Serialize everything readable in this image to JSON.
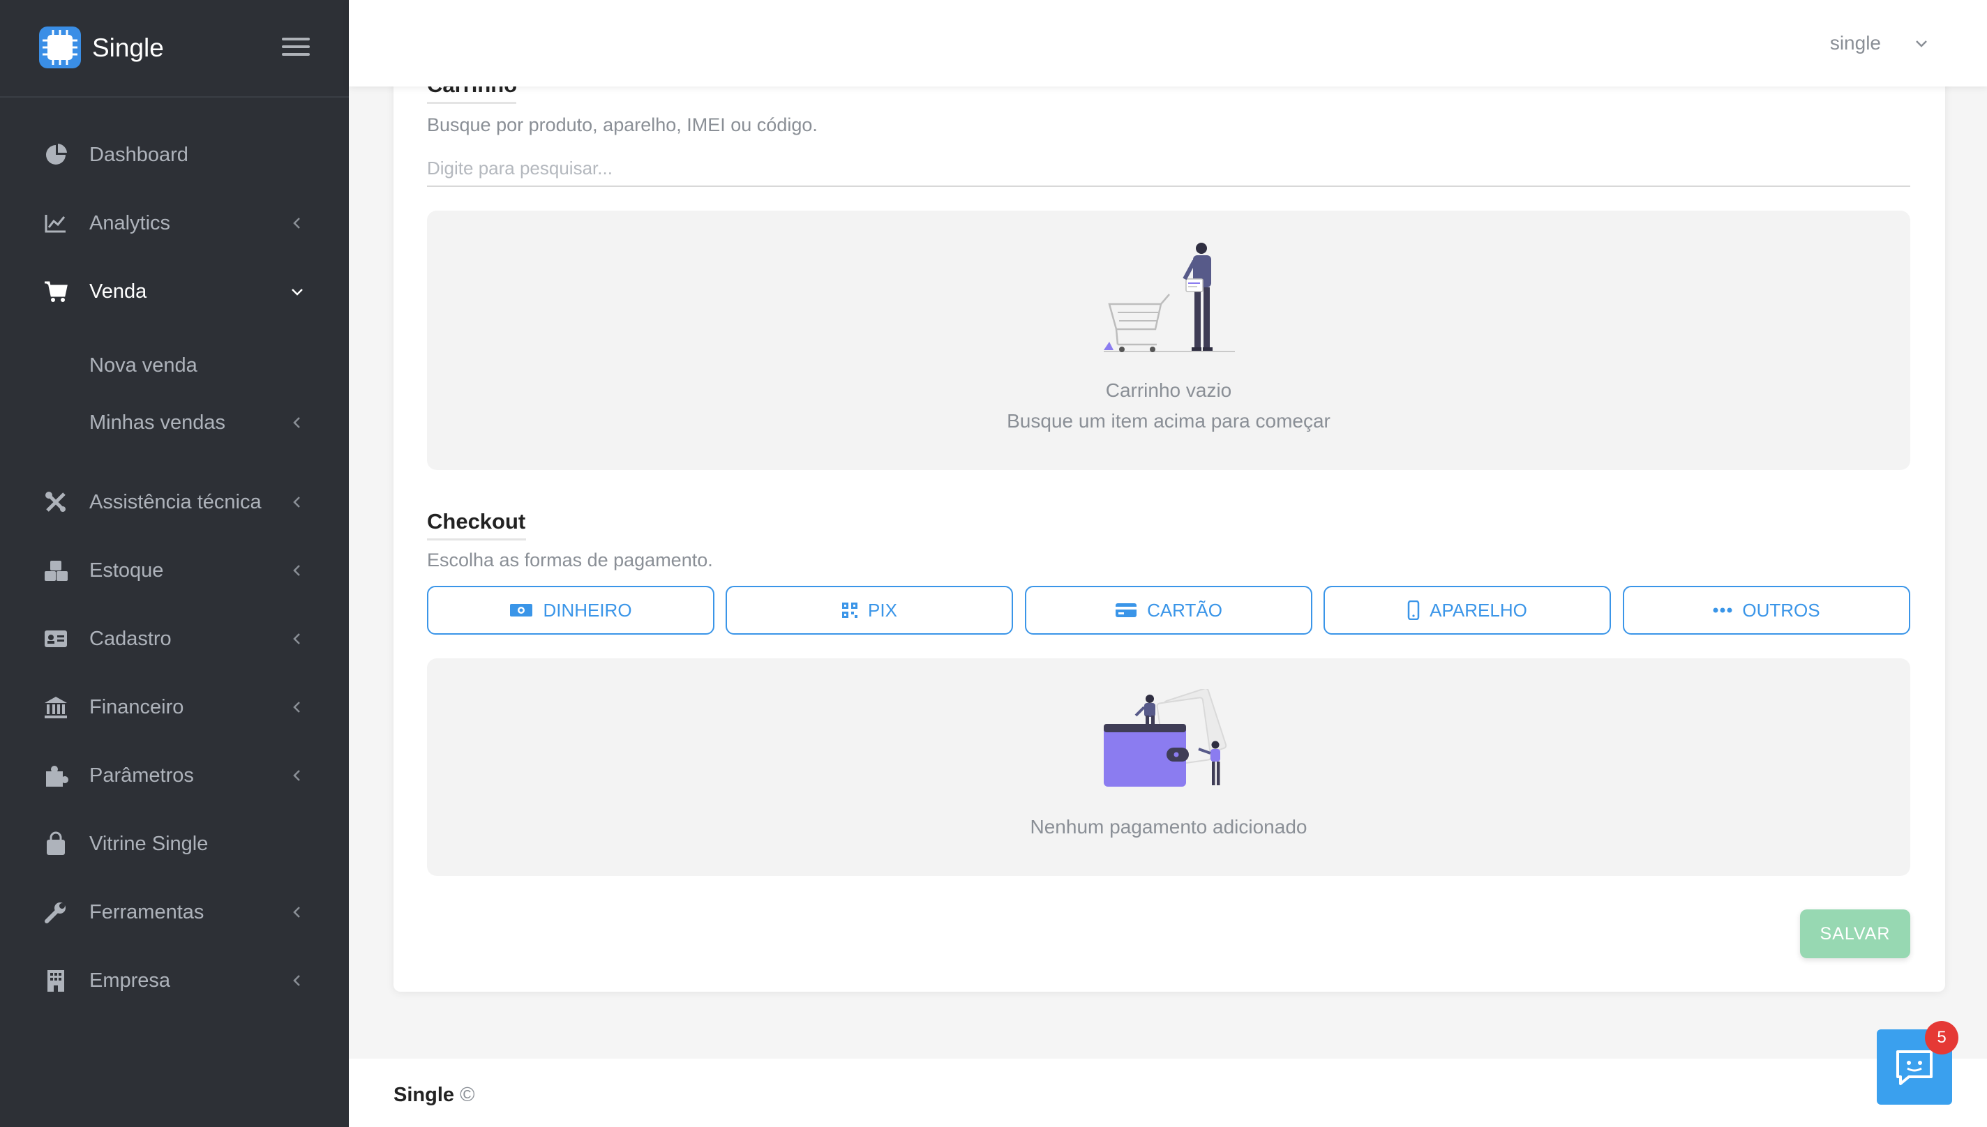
{
  "app": {
    "name": "Single"
  },
  "sidebar": {
    "items": [
      {
        "label": "Dashboard",
        "icon": "pie-chart-icon"
      },
      {
        "label": "Analytics",
        "icon": "line-chart-icon"
      },
      {
        "label": "Venda",
        "icon": "shopping-cart-icon",
        "expanded": true,
        "children": [
          {
            "label": "Nova venda"
          },
          {
            "label": "Minhas vendas"
          }
        ]
      },
      {
        "label": "Assistência técnica",
        "icon": "tools-icon"
      },
      {
        "label": "Estoque",
        "icon": "boxes-icon"
      },
      {
        "label": "Cadastro",
        "icon": "id-card-icon"
      },
      {
        "label": "Financeiro",
        "icon": "bank-icon"
      },
      {
        "label": "Parâmetros",
        "icon": "puzzle-icon"
      },
      {
        "label": "Vitrine Single",
        "icon": "shopping-bag-icon"
      },
      {
        "label": "Ferramentas",
        "icon": "wrench-icon"
      },
      {
        "label": "Empresa",
        "icon": "building-icon"
      }
    ]
  },
  "header": {
    "user": "single"
  },
  "cart": {
    "title": "Carrinho",
    "subtitle": "Busque por produto, aparelho, IMEI ou código.",
    "search_placeholder": "Digite para pesquisar...",
    "empty_title": "Carrinho vazio",
    "empty_subtitle": "Busque um item acima para começar"
  },
  "checkout": {
    "title": "Checkout",
    "subtitle": "Escolha as formas de pagamento.",
    "methods": [
      {
        "label": "DINHEIRO",
        "icon": "cash-icon"
      },
      {
        "label": "PIX",
        "icon": "qr-code-icon"
      },
      {
        "label": "CARTÃO",
        "icon": "credit-card-icon"
      },
      {
        "label": "APARELHO",
        "icon": "smartphone-icon"
      },
      {
        "label": "OUTROS",
        "icon": "more-dots-icon"
      }
    ],
    "empty_text": "Nenhum pagamento adicionado"
  },
  "actions": {
    "save_label": "SALVAR"
  },
  "footer": {
    "brand": "Single",
    "copy": "©"
  },
  "chat": {
    "badge_count": "5"
  },
  "colors": {
    "accent": "#3a95e8",
    "sidebar": "#2d3036",
    "save": "#97d8b2",
    "illustration": "#8b7cf0"
  }
}
